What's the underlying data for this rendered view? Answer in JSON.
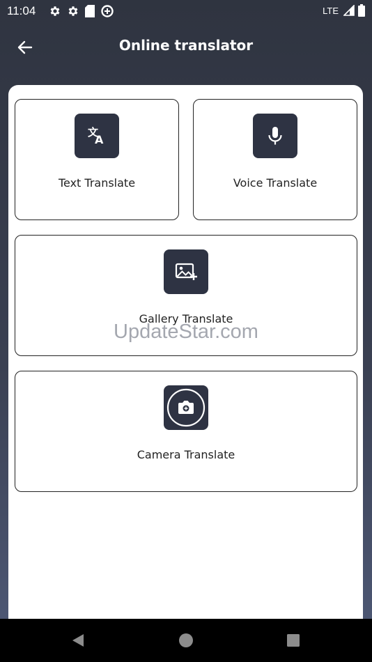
{
  "status_bar": {
    "time": "11:04",
    "network": "LTE",
    "icons": [
      "gear-icon",
      "gear-icon",
      "sd-card-icon",
      "data-saver-icon",
      "signal-icon",
      "battery-icon"
    ]
  },
  "header": {
    "title": "Online translator",
    "back_icon": "arrow-left-icon"
  },
  "cards": {
    "text": {
      "label": "Text Translate",
      "icon": "translate-icon"
    },
    "voice": {
      "label": "Voice Translate",
      "icon": "microphone-icon"
    },
    "gallery": {
      "label": "Gallery Translate",
      "icon": "image-add-icon"
    },
    "camera": {
      "label": "Camera Translate",
      "icon": "camera-icon"
    }
  },
  "watermark": "UpdateStar.com",
  "nav": {
    "icons": [
      "back-triangle-icon",
      "home-circle-icon",
      "recents-square-icon"
    ]
  },
  "colors": {
    "header_bg": "#2f3440",
    "tile_bg": "#2e3343",
    "card_border": "#222222",
    "panel_bg": "#ffffff"
  }
}
